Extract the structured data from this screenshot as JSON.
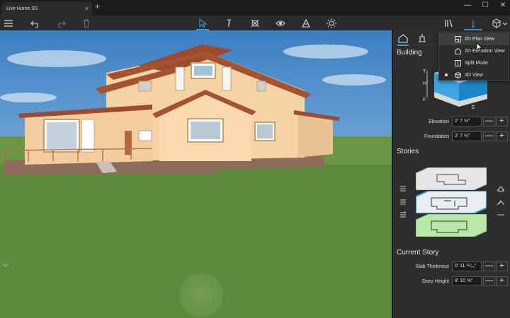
{
  "window": {
    "tab_title": "Live Home 3D",
    "tab_close": "×",
    "new_tab": "+",
    "minimize": "—",
    "maximize": "☐",
    "close": "✕"
  },
  "toolbar": {
    "icons": [
      "menu-icon",
      "undo-icon",
      "redo-icon",
      "delete-icon",
      "select-icon",
      "walk-icon",
      "orbit-icon",
      "view-icon",
      "materials-icon",
      "light-icon",
      "library-icon",
      "info-icon",
      "view-mode-icon"
    ],
    "accent_color": "#3a9ad9"
  },
  "panel": {
    "building_title": "Building",
    "diagram_labels": {
      "top": "T",
      "height": "H",
      "foundation": "F",
      "elevation": "E"
    },
    "elevation_label": "Elevation",
    "elevation_value": "2' 7 ½\"",
    "foundation_label": "Foundation",
    "foundation_value": "2' 7 ½\"",
    "stories_title": "Stories",
    "current_story_title": "Current Story",
    "slab_label": "Slab Thickness",
    "slab_value": "0' 11 ¹⁵⁄₁₆\"",
    "story_height_label": "Story Height",
    "story_height_value": "9' 10 ⅝\"",
    "minus": "—",
    "plus": "+"
  },
  "view_menu": {
    "items": [
      {
        "label": "2D Plan View",
        "icon": "plan-view-icon",
        "selected": false
      },
      {
        "label": "2D Elevation View",
        "icon": "elevation-view-icon",
        "selected": false
      },
      {
        "label": "Split Mode",
        "icon": "split-mode-icon",
        "selected": false
      },
      {
        "label": "3D View",
        "icon": "3d-view-icon",
        "selected": true
      }
    ]
  }
}
